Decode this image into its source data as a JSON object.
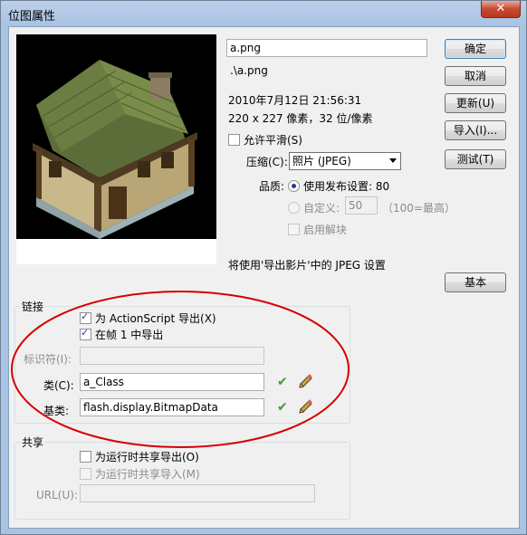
{
  "window": {
    "title": "位图属性",
    "close_glyph": "✕"
  },
  "image": {
    "name": "a.png",
    "path": ".\\a.png",
    "date": "2010年7月12日  21:56:31",
    "dimensions": "220 x 227 像素，32 位/像素"
  },
  "options": {
    "allow_smoothing": "允许平滑(S)",
    "allow_smoothing_checked": false
  },
  "compression": {
    "label": "压缩(C):",
    "value": "照片 (JPEG)"
  },
  "quality": {
    "label": "品质:",
    "use_publish": "使用发布设置: 80",
    "custom": "自定义:",
    "custom_value": "50",
    "custom_hint": "（100=最高）",
    "deblocking": "启用解块"
  },
  "jpeg_note": "将使用'导出影片'中的 JPEG 设置",
  "buttons": {
    "ok": "确定",
    "cancel": "取消",
    "update": "更新(U)",
    "import": "导入(I)...",
    "test": "测试(T)",
    "basic": "基本"
  },
  "linkage": {
    "title": "链接",
    "export_as": "为 ActionScript 导出(X)",
    "export_frame1": "在帧 1 中导出",
    "identifier_label": "标识符(I):",
    "identifier_value": "",
    "class_label": "类(C):",
    "class_value": "a_Class",
    "base_label": "基类:",
    "base_value": "flash.display.BitmapData"
  },
  "sharing": {
    "title": "共享",
    "export_runtime": "为运行时共享导出(O)",
    "import_runtime": "为运行时共享导入(M)",
    "url_label": "URL(U):",
    "url_value": ""
  },
  "colors": {
    "ellipse": "#d40000",
    "checkmark": "#3f9a2a",
    "close": "#c7482f"
  },
  "icons": {
    "checkmark": "✔",
    "pencil": "pencil-icon",
    "preview": "house-thumbnail"
  }
}
